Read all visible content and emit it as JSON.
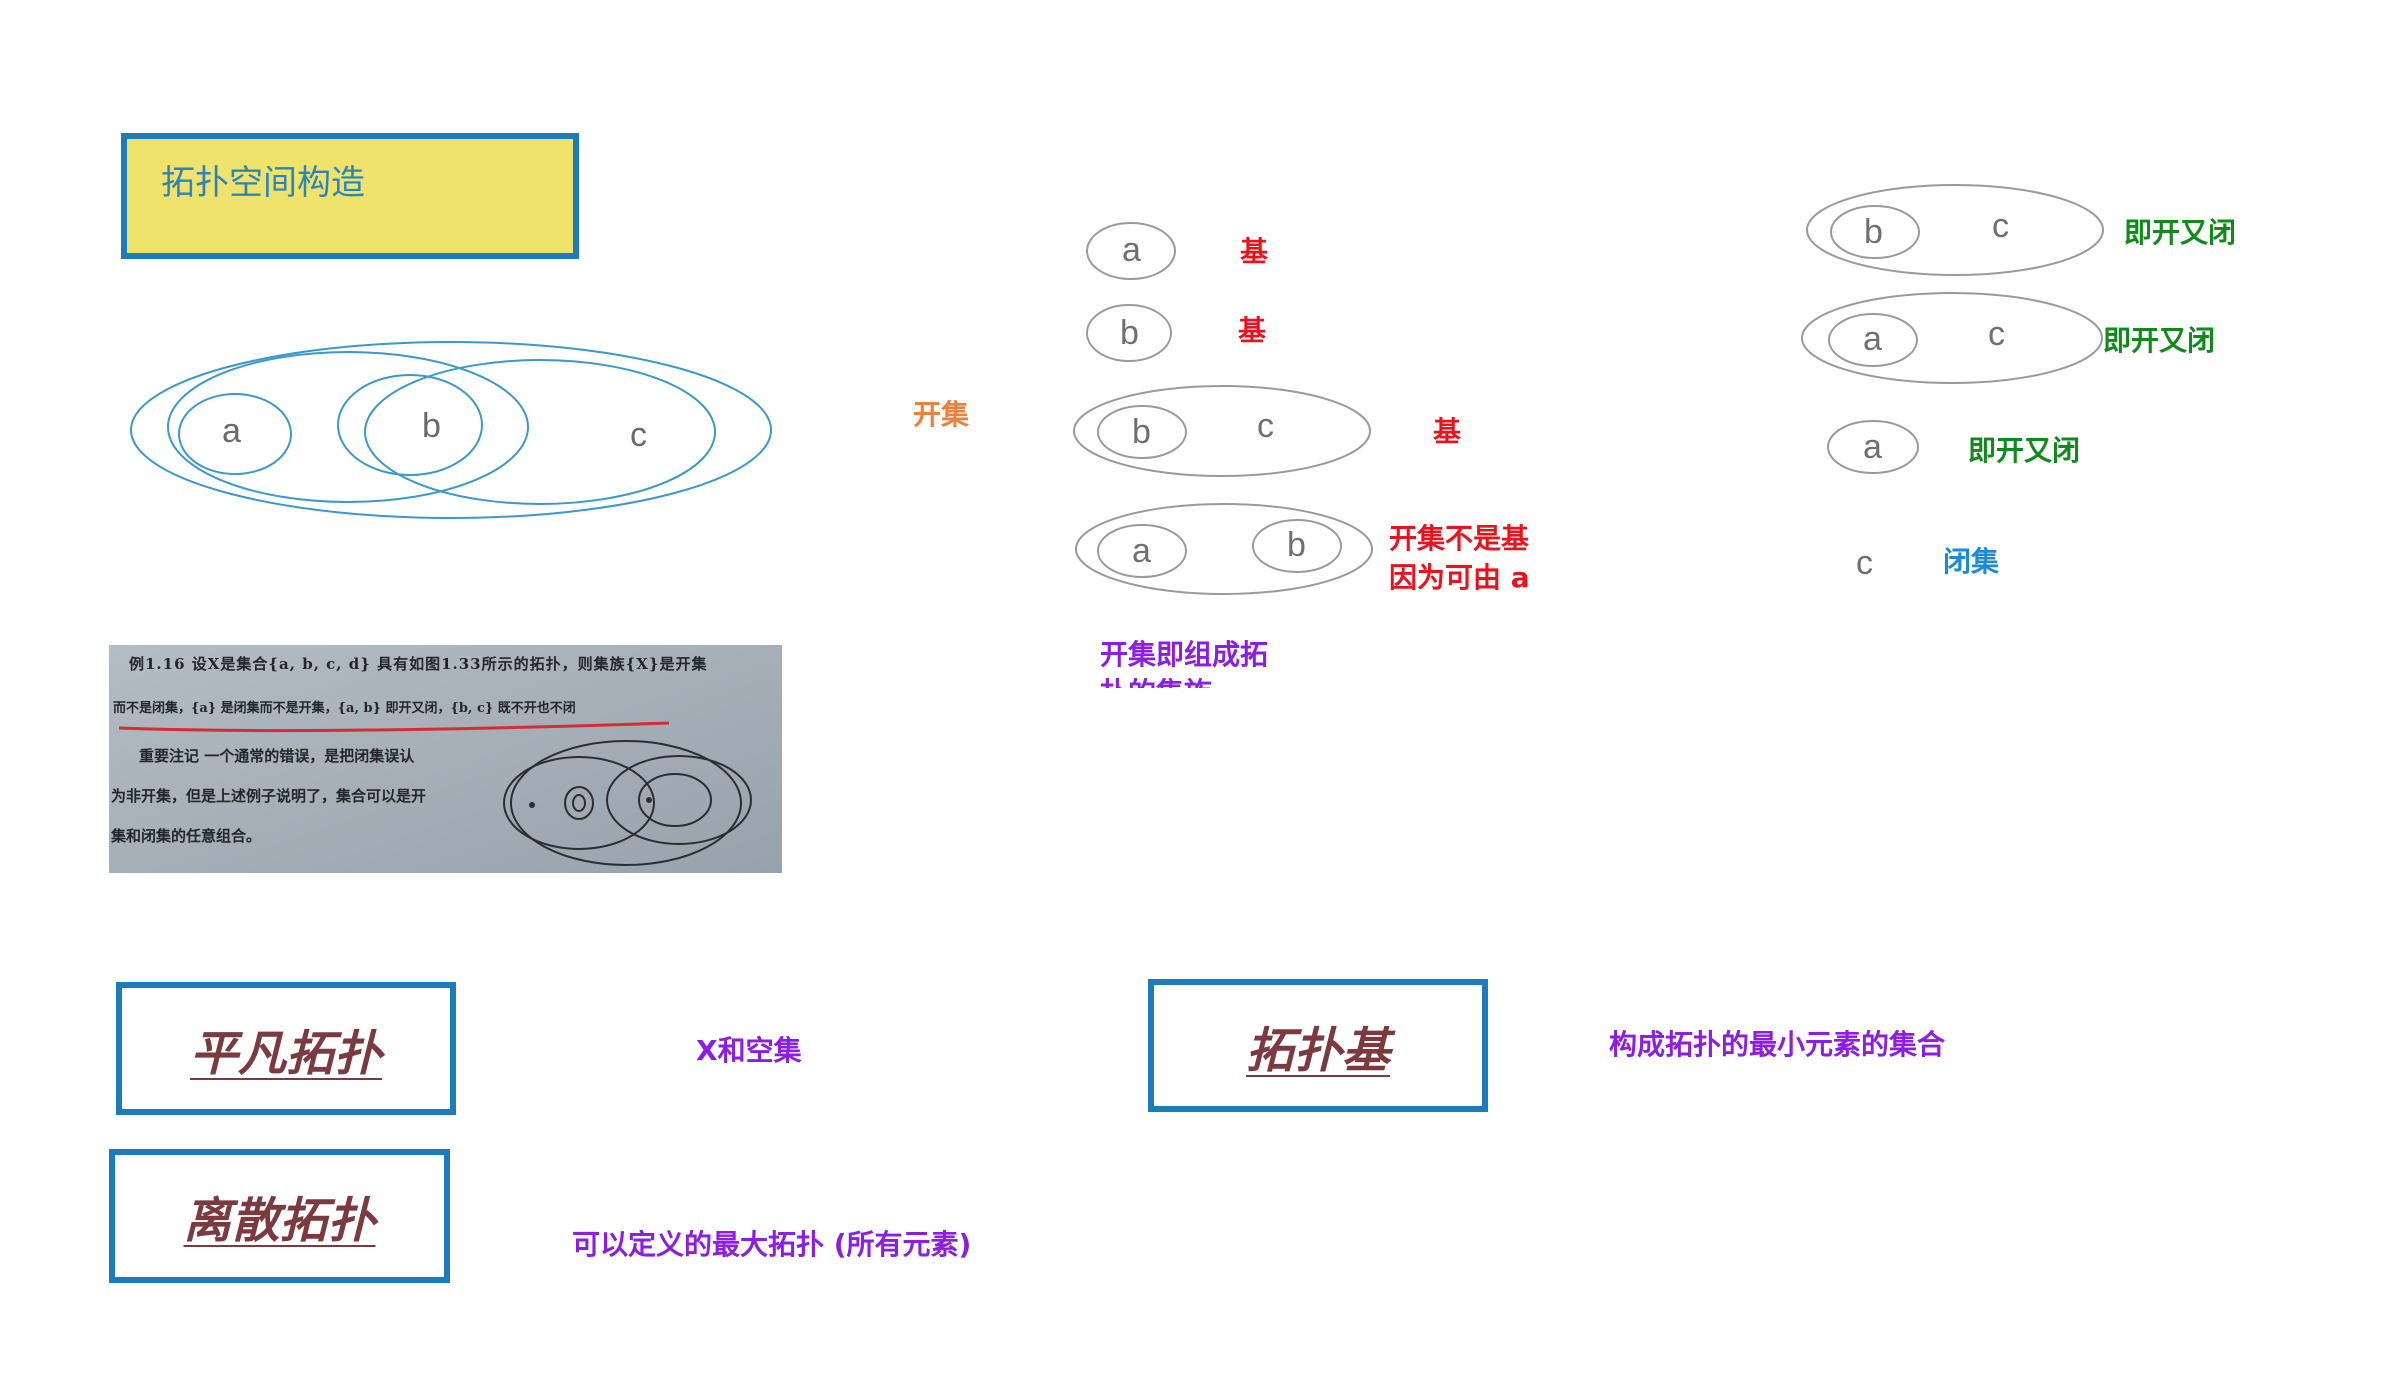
{
  "title": "拓扑空间构造",
  "venn": {
    "letters": [
      "a",
      "b",
      "c"
    ]
  },
  "open_set_label": "开集",
  "bases": {
    "set_a": {
      "letters": [
        "a"
      ],
      "label": "基"
    },
    "set_b": {
      "letters": [
        "b"
      ],
      "label": "基"
    },
    "set_bc": {
      "letters": [
        "b",
        "c"
      ],
      "label": "基"
    },
    "set_ab": {
      "letters": [
        "a",
        "b"
      ],
      "label_line1": "开集不是基",
      "label_line2": "因为可由 a"
    }
  },
  "open_sets_note": "开集即组成拓扑的集族",
  "clopen": {
    "set_bc": {
      "letters": [
        "b",
        "c"
      ],
      "label": "即开又闭"
    },
    "set_ac": {
      "letters": [
        "a",
        "c"
      ],
      "label": "即开又闭"
    },
    "set_a": {
      "letters": [
        "a"
      ],
      "label": "即开又闭"
    },
    "set_c": {
      "letters": [
        "c"
      ],
      "label": "闭集"
    }
  },
  "photo": {
    "line1": "例1.16  设X是集合{a, b, c, d} 具有如图1.33所示的拓扑，则集族{X}是开集",
    "line2": "而不是闭集，{a} 是闭集而不是开集，{a, b} 即开又闭，{b, c} 既不开也不闭",
    "line3": "重要注记  一个通常的错误，是把闭集误认",
    "line4": "为非开集，但是上述例子说明了，集合可以是开",
    "line5": "集和闭集的任意组合。"
  },
  "terms": {
    "trivial": {
      "name": "平凡拓扑",
      "desc": "X和空集"
    },
    "discrete": {
      "name": "离散拓扑",
      "desc": "可以定义的最大拓扑 (所有元素)"
    },
    "basis": {
      "name": "拓扑基",
      "desc": "构成拓扑的最小元素的集合"
    }
  },
  "colors": {
    "title_bg": "#f0e36c",
    "border_blue": "#1c7bbd",
    "red": "#e8141d",
    "green": "#0f8a1b",
    "purple": "#8b1ee0",
    "orange": "#f07f3a",
    "term_text": "#7b3a3f"
  }
}
